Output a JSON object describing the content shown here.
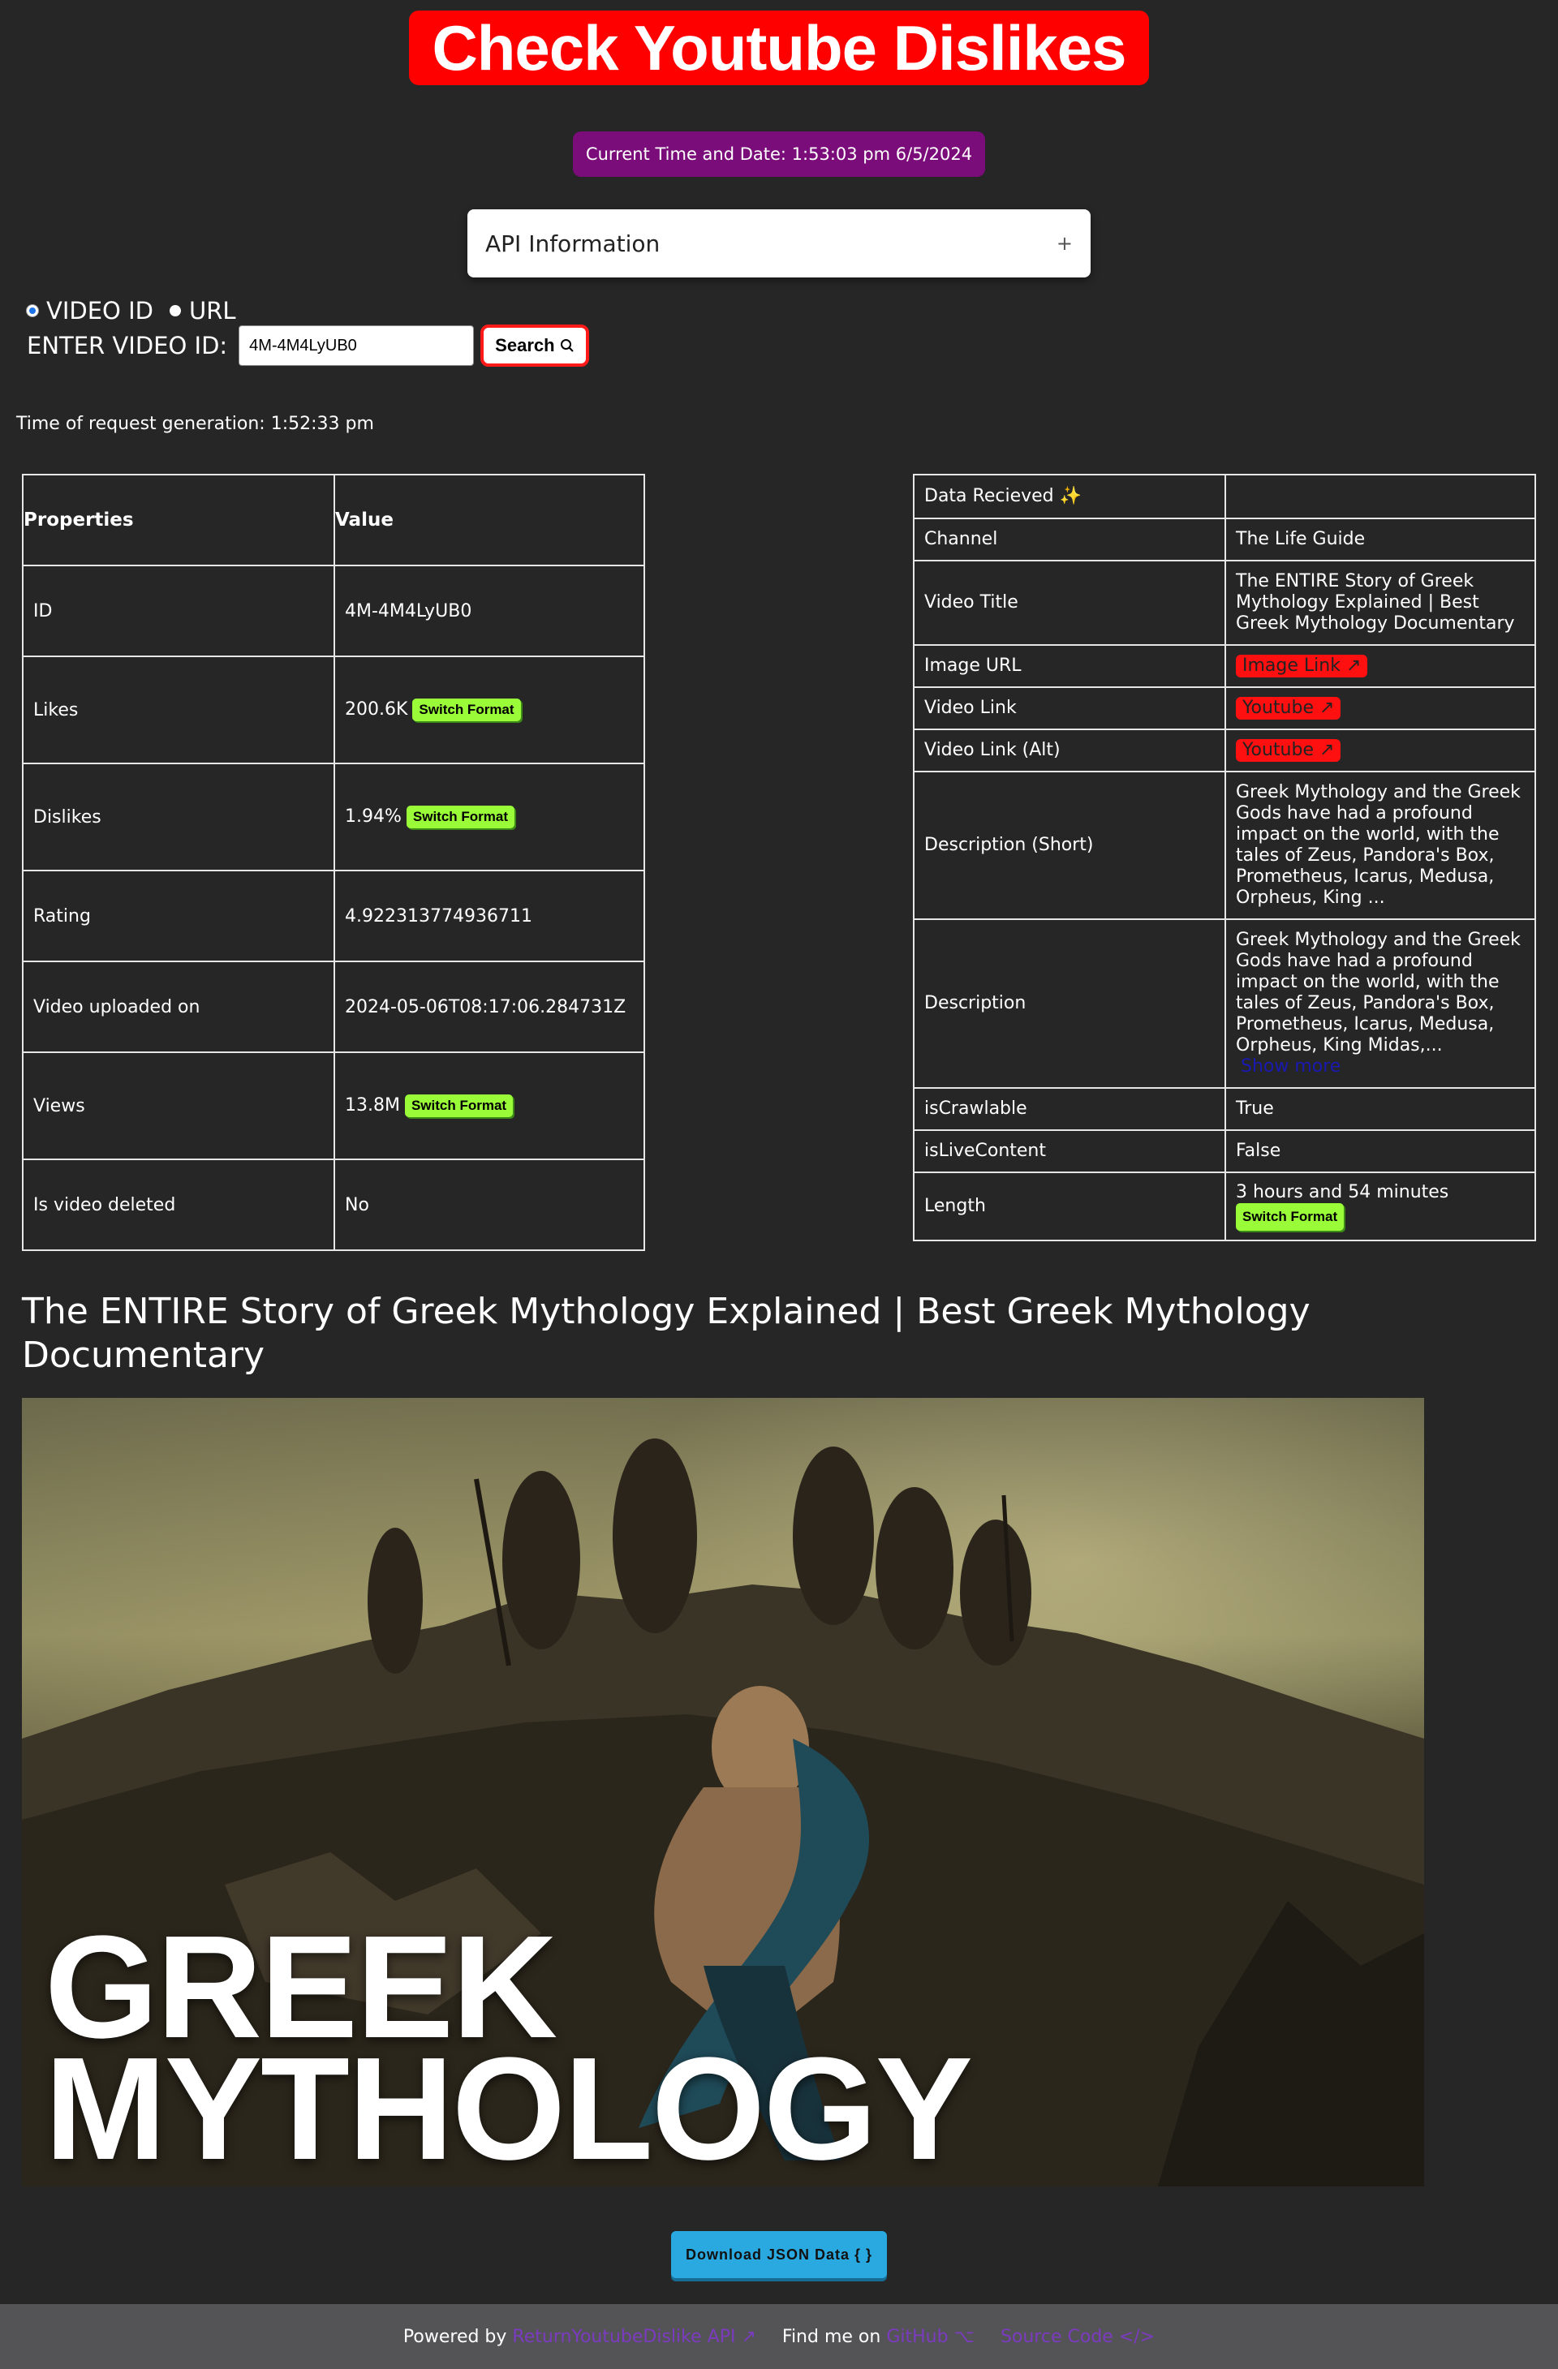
{
  "header": {
    "title": "Check Youtube Dislikes",
    "current_time": "Current Time and Date: 1:53:03 pm 6/5/2024"
  },
  "accordion": {
    "label": "API Information",
    "toggle": "+"
  },
  "search": {
    "mode_video_id": "VIDEO ID",
    "mode_url": "URL",
    "selected_mode": "VIDEO ID",
    "input_label": "ENTER VIDEO ID:",
    "input_value": "4M-4M4LyUB0",
    "button_label": "Search",
    "button_icon": "search-icon"
  },
  "request_time": "Time of request generation: 1:52:33 pm",
  "properties_table": {
    "headers": [
      "Properties",
      "Value"
    ],
    "switch_label": "Switch Format",
    "rows": [
      {
        "property": "ID",
        "value": "4M-4M4LyUB0"
      },
      {
        "property": "Likes",
        "value": "200.6K"
      },
      {
        "property": "Dislikes",
        "value": "1.94%"
      },
      {
        "property": "Rating",
        "value": "4.922313774936711"
      },
      {
        "property": "Video uploaded on",
        "value": "2024-05-06T08:17:06.284731Z"
      },
      {
        "property": "Views",
        "value": "13.8M"
      },
      {
        "property": "Is video deleted",
        "value": "No"
      }
    ]
  },
  "data_table": {
    "header_label": "Data Recieved ✨",
    "header_value": "",
    "rows": [
      {
        "property": "Channel",
        "value": "The Life Guide"
      },
      {
        "property": "Video Title",
        "value": "The ENTIRE Story of Greek Mythology Explained | Best Greek Mythology Documentary"
      },
      {
        "property": "Image URL",
        "link": "Image Link"
      },
      {
        "property": "Video Link",
        "link": "Youtube"
      },
      {
        "property": "Video Link (Alt)",
        "link": "Youtube"
      },
      {
        "property": "Description (Short)",
        "value": "Greek Mythology and the Greek Gods have had a profound impact on the world, with the tales of Zeus, Pandora's Box, Prometheus, Icarus, Medusa, Orpheus, King ..."
      },
      {
        "property": "Description",
        "value": "Greek Mythology and the Greek Gods have had a profound impact on the world, with the tales of Zeus, Pandora's Box, Prometheus, Icarus, Medusa, Orpheus, King Midas,...",
        "show_more": "Show more"
      },
      {
        "property": "isCrawlable",
        "value": "True"
      },
      {
        "property": "isLiveContent",
        "value": "False"
      },
      {
        "property": "Length",
        "value": "3 hours and 54 minutes",
        "switch_label": "Switch Format"
      }
    ]
  },
  "video": {
    "title": "The ENTIRE Story of Greek Mythology Explained | Best Greek Mythology Documentary",
    "thumbnail_text_1": "GREEK",
    "thumbnail_text_2": "MYTHOLOGY"
  },
  "download_label": "Download JSON Data { }",
  "footer": {
    "powered_by": "Powered by",
    "api_link": "ReturnYoutubeDislike API",
    "find_me": "Find me on",
    "github_link": "GitHub",
    "source_link": "Source Code"
  }
}
